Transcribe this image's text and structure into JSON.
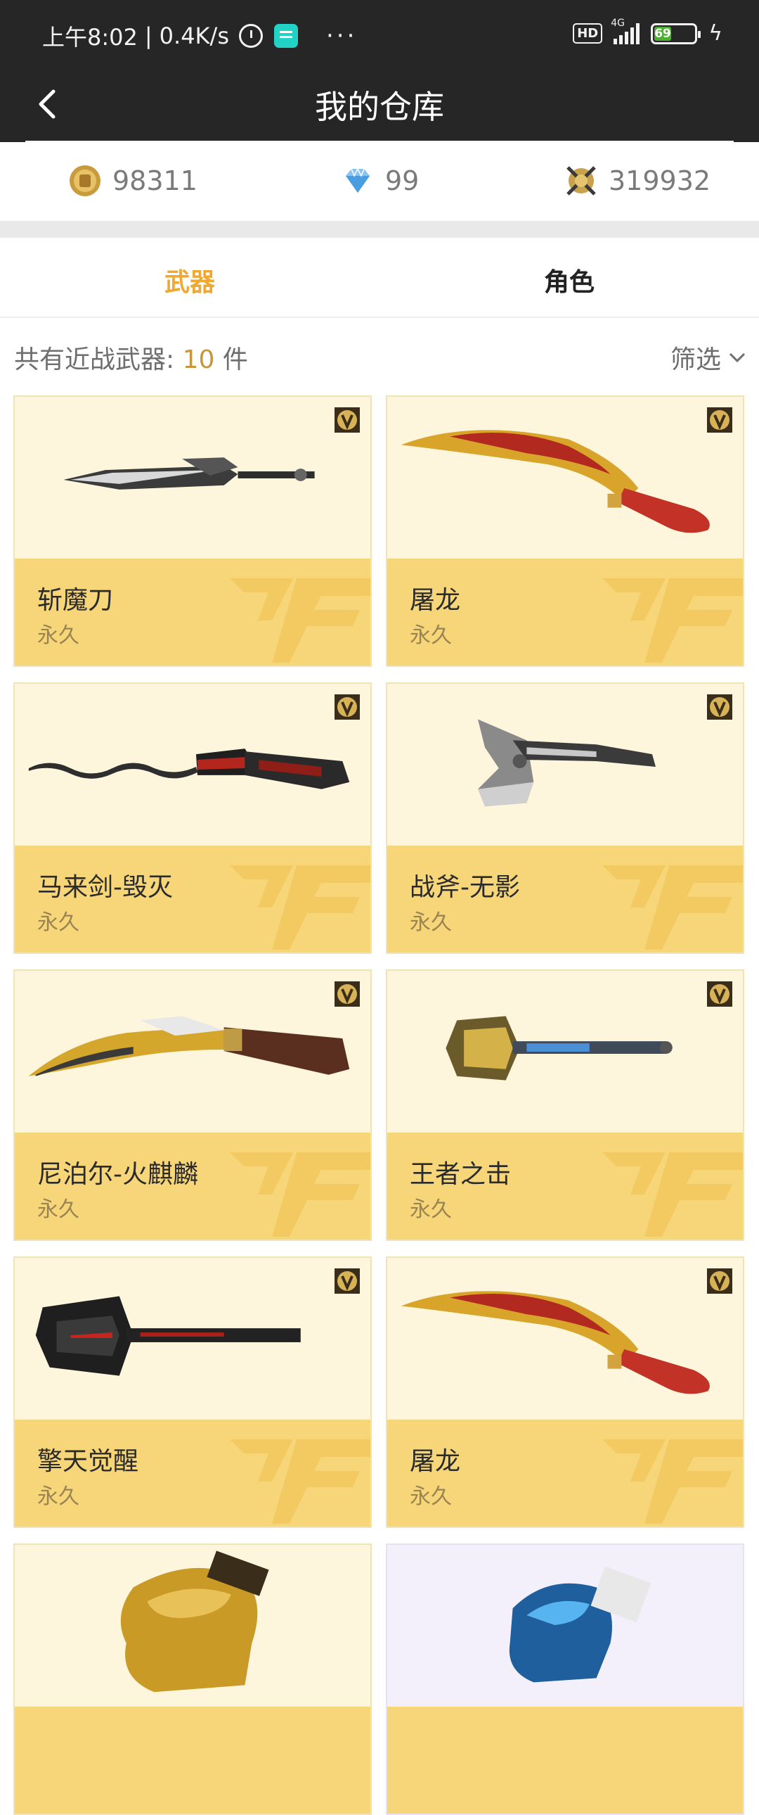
{
  "status_bar": {
    "time": "上午8:02",
    "speed": "0.4K/s",
    "hd": "HD",
    "network": "4G",
    "battery": "69"
  },
  "header": {
    "title": "我的仓库"
  },
  "currency": {
    "gold": "98311",
    "diamond": "99",
    "medal": "319932"
  },
  "tabs": [
    {
      "label": "武器",
      "active": true
    },
    {
      "label": "角色",
      "active": false
    }
  ],
  "count": {
    "prefix": "共有近战武器:",
    "number": "10",
    "suffix": "件",
    "filter_label": "筛选"
  },
  "items": [
    {
      "name": "斩魔刀",
      "duration": "永久",
      "icon": "sword-icon"
    },
    {
      "name": "屠龙",
      "duration": "永久",
      "icon": "dragon-blade-icon"
    },
    {
      "name": "马来剑-毁灭",
      "duration": "永久",
      "icon": "kris-sword-icon"
    },
    {
      "name": "战斧-无影",
      "duration": "永久",
      "icon": "axe-icon"
    },
    {
      "name": "尼泊尔-火麒麟",
      "duration": "永久",
      "icon": "kukri-icon"
    },
    {
      "name": "王者之击",
      "duration": "永久",
      "icon": "shovel-icon"
    },
    {
      "name": "擎天觉醒",
      "duration": "永久",
      "icon": "shovel-dark-icon"
    },
    {
      "name": "屠龙",
      "duration": "永久",
      "icon": "dragon-blade-icon"
    },
    {
      "name": "",
      "duration": "",
      "icon": "gold-glove-icon"
    },
    {
      "name": "",
      "duration": "",
      "icon": "blue-glove-icon"
    }
  ]
}
